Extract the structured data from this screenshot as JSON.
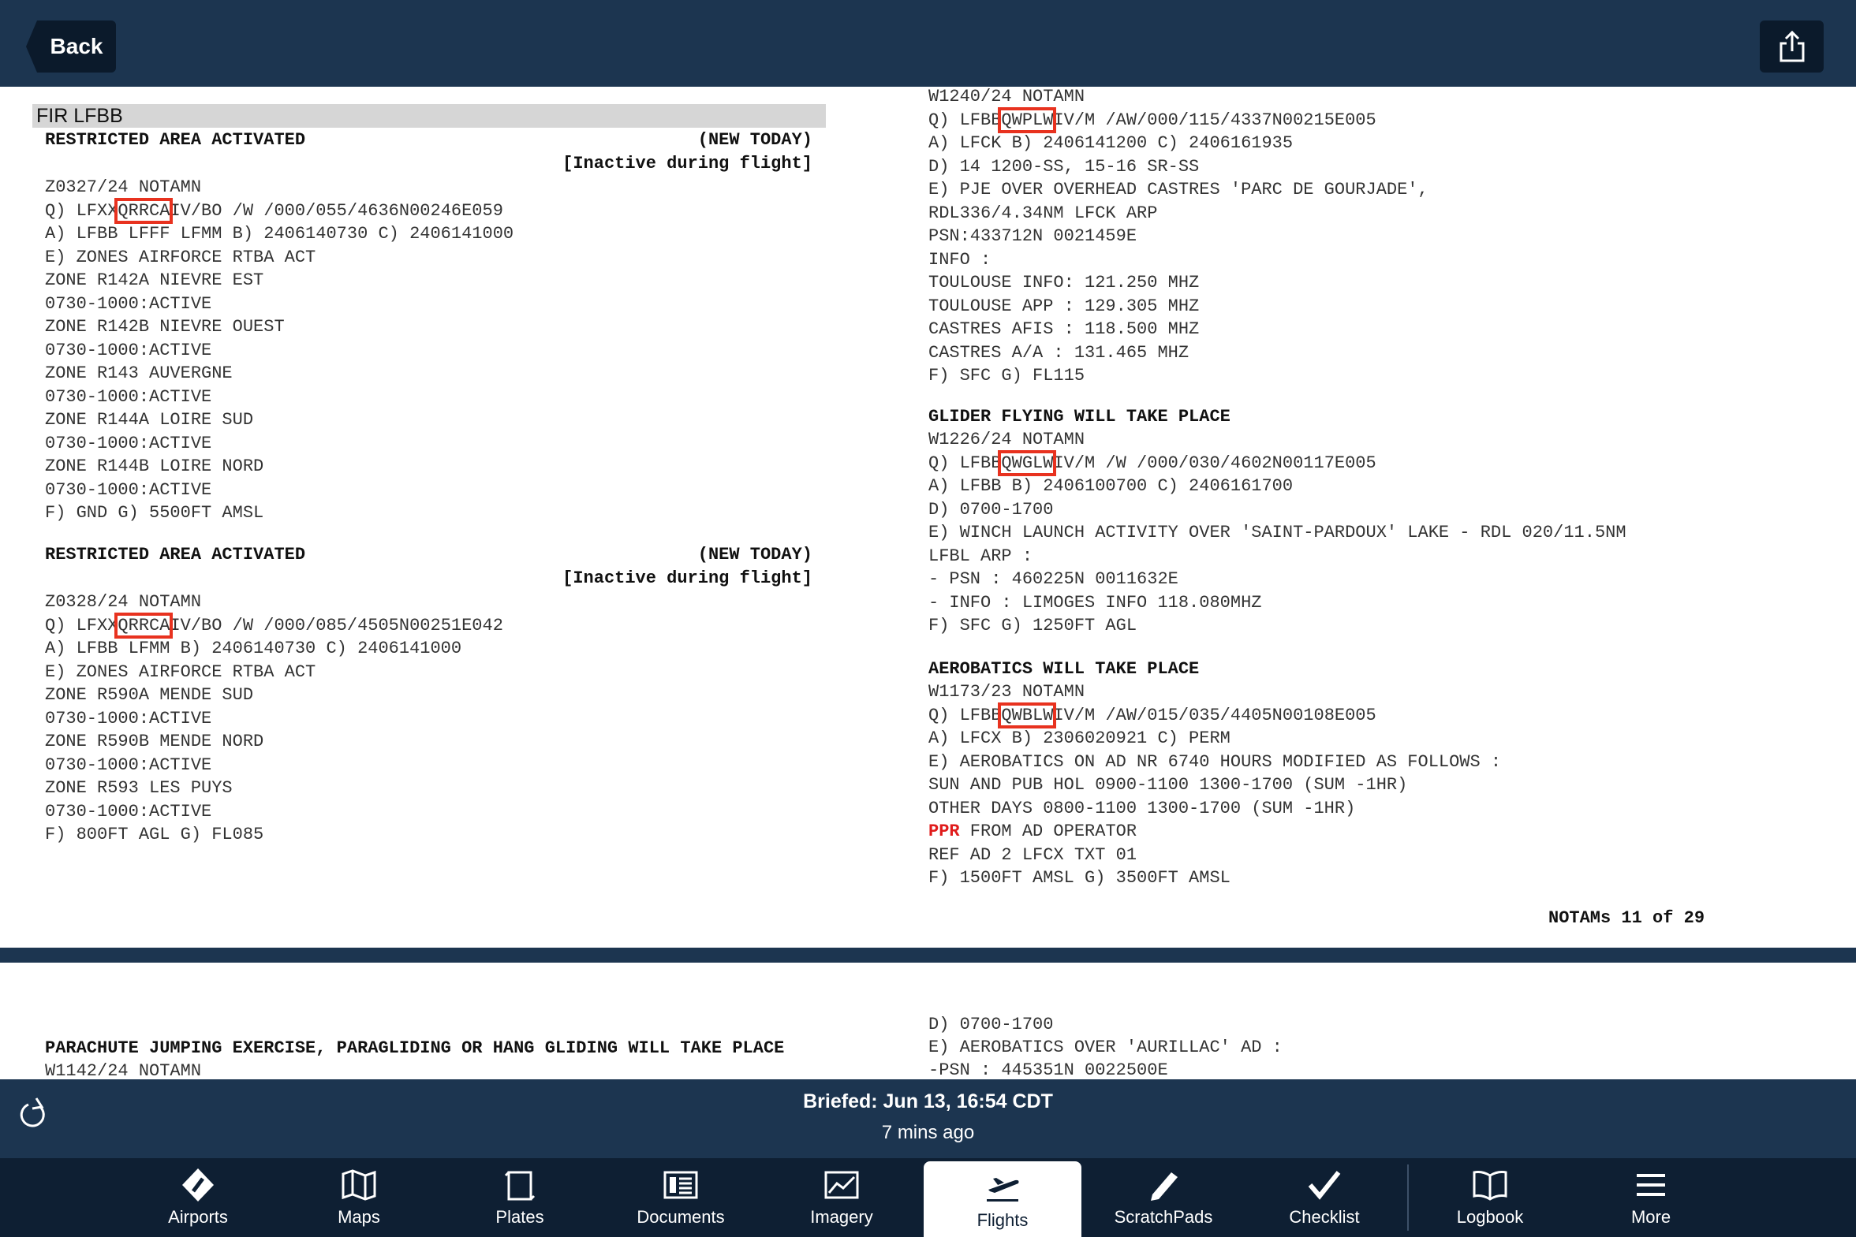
{
  "header": {
    "back_label": "Back"
  },
  "page1": {
    "fir_label": "FIR   LFBB",
    "left": [
      {
        "t": "RESTRICTED AREA ACTIVATED",
        "cls": "hdr"
      },
      {
        "t": "Z0327/24 NOTAMN"
      },
      {
        "t": "Q) LFXX/",
        "box": "QRRCA",
        "after": "/IV/BO /W /000/055/4636N00246E059"
      },
      {
        "t": "A) LFBB LFFF LFMM B) 2406140730 C) 2406141000"
      },
      {
        "t": "E) ZONES AIRFORCE RTBA ACT"
      },
      {
        "t": "ZONE R142A NIEVRE EST"
      },
      {
        "t": "0730-1000:ACTIVE"
      },
      {
        "t": "ZONE R142B NIEVRE OUEST"
      },
      {
        "t": "0730-1000:ACTIVE"
      },
      {
        "t": "ZONE R143 AUVERGNE"
      },
      {
        "t": "0730-1000:ACTIVE"
      },
      {
        "t": "ZONE R144A LOIRE SUD"
      },
      {
        "t": "0730-1000:ACTIVE"
      },
      {
        "t": "ZONE R144B LOIRE NORD"
      },
      {
        "t": "0730-1000:ACTIVE"
      },
      {
        "t": "F) GND G) 5500FT AMSL"
      },
      {
        "t": "RESTRICTED AREA ACTIVATED",
        "cls": "hdr"
      },
      {
        "t": "Z0328/24 NOTAMN"
      },
      {
        "t": "Q) LFXX/",
        "box": "QRRCA",
        "after": "/IV/BO /W /000/085/4505N00251E042"
      },
      {
        "t": "A) LFBB LFMM B) 2406140730 C) 2406141000"
      },
      {
        "t": "E) ZONES AIRFORCE RTBA ACT"
      },
      {
        "t": "ZONE R590A MENDE SUD"
      },
      {
        "t": "0730-1000:ACTIVE"
      },
      {
        "t": "ZONE R590B MENDE NORD"
      },
      {
        "t": "0730-1000:ACTIVE"
      },
      {
        "t": "ZONE R593 LES PUYS"
      },
      {
        "t": "0730-1000:ACTIVE"
      },
      {
        "t": "F) 800FT AGL G) FL085"
      }
    ],
    "left_right_tags": [
      {
        "t": "(NEW TODAY)"
      },
      {
        "t": "[Inactive during flight]"
      },
      {
        "t": "(NEW TODAY)"
      },
      {
        "t": "[Inactive during flight]"
      }
    ],
    "right": [
      {
        "t": "W1240/24 NOTAMN"
      },
      {
        "t": "Q) LFBB/",
        "box": "QWPLW",
        "after": "/IV/M /AW/000/115/4337N00215E005"
      },
      {
        "t": "A) LFCK B) 2406141200 C) 2406161935"
      },
      {
        "t": "D) 14 1200-SS, 15-16 SR-SS"
      },
      {
        "t": "E) PJE OVER OVERHEAD CASTRES 'PARC DE GOURJADE',"
      },
      {
        "t": "RDL336/4.34NM LFCK ARP"
      },
      {
        "t": "PSN:433712N 0021459E"
      },
      {
        "t": "INFO :"
      },
      {
        "t": "TOULOUSE INFO: 121.250 MHZ"
      },
      {
        "t": "TOULOUSE APP : 129.305 MHZ"
      },
      {
        "t": "CASTRES AFIS : 118.500 MHZ"
      },
      {
        "t": "CASTRES A/A : 131.465 MHZ"
      },
      {
        "t": "F) SFC G) FL115"
      },
      {
        "t": "GLIDER FLYING WILL TAKE PLACE",
        "cls": "hdr"
      },
      {
        "t": "W1226/24 NOTAMN"
      },
      {
        "t": "Q) LFBB/",
        "box": "QWGLW",
        "after": "/IV/M /W /000/030/4602N00117E005"
      },
      {
        "t": "A) LFBB B) 2406100700 C) 2406161700"
      },
      {
        "t": "D) 0700-1700"
      },
      {
        "t": "E) WINCH LAUNCH ACTIVITY OVER 'SAINT-PARDOUX' LAKE - RDL 020/11.5NM"
      },
      {
        "t": "LFBL ARP :"
      },
      {
        "t": "- PSN : 460225N 0011632E"
      },
      {
        "t": "- INFO : LIMOGES INFO 118.080MHZ"
      },
      {
        "t": "F) SFC G) 1250FT AGL"
      },
      {
        "t": "AEROBATICS WILL TAKE PLACE",
        "cls": "hdr"
      },
      {
        "t": "W1173/23 NOTAMN"
      },
      {
        "t": "Q) LFBB/",
        "box": "QWBLW",
        "after": "/IV/M /AW/015/035/4405N00108E005"
      },
      {
        "t": "A) LFCX B) 2306020921 C) PERM"
      },
      {
        "t": "E) AEROBATICS ON AD NR 6740 HOURS MODIFIED AS FOLLOWS :"
      },
      {
        "t": "SUN AND PUB HOL 0900-1100 1300-1700 (SUM -1HR)"
      },
      {
        "t": "OTHER DAYS 0800-1100 1300-1700 (SUM -1HR)"
      },
      {
        "t": "",
        "ppr": "PPR",
        "after": " FROM AD OPERATOR"
      },
      {
        "t": "REF AD 2 LFCX TXT 01"
      },
      {
        "t": "F) 1500FT AMSL G) 3500FT AMSL"
      }
    ],
    "page_counter": "NOTAMs 11 of 29"
  },
  "page2": {
    "left": [
      {
        "t": "PARACHUTE JUMPING EXERCISE, PARAGLIDING OR HANG GLIDING WILL TAKE PLACE",
        "cls": "hdr"
      },
      {
        "t": "W1142/24 NOTAMN"
      }
    ],
    "right": [
      {
        "t": "D) 0700-1700"
      },
      {
        "t": "E) AEROBATICS OVER 'AURILLAC' AD :"
      },
      {
        "t": "-PSN : 445351N 0022500E"
      }
    ]
  },
  "status": {
    "briefed": "Briefed: Jun 13, 16:54 CDT",
    "ago": "7 mins ago"
  },
  "tabs": [
    {
      "label": "Airports",
      "icon": "airports-icon"
    },
    {
      "label": "Maps",
      "icon": "maps-icon"
    },
    {
      "label": "Plates",
      "icon": "plates-icon"
    },
    {
      "label": "Documents",
      "icon": "documents-icon"
    },
    {
      "label": "Imagery",
      "icon": "imagery-icon"
    },
    {
      "label": "Flights",
      "icon": "flights-icon",
      "active": true
    },
    {
      "label": "ScratchPads",
      "icon": "scratchpads-icon"
    },
    {
      "label": "Checklist",
      "icon": "checklist-icon"
    },
    {
      "label": "Logbook",
      "icon": "logbook-icon"
    },
    {
      "label": "More",
      "icon": "more-icon"
    }
  ],
  "colors": {
    "nav_bg": "#1c3550",
    "tab_bg": "#0e1f33",
    "highlight_box": "#e8321f",
    "ppr": "#e01b1b"
  }
}
